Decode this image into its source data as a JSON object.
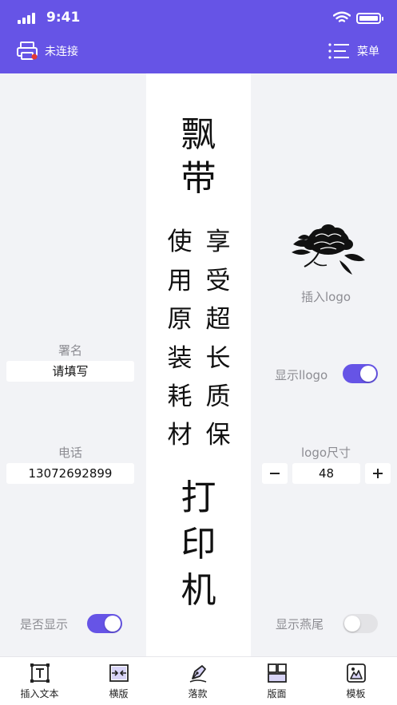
{
  "status_bar": {
    "time": "9:41"
  },
  "header": {
    "printer_label": "未连接",
    "menu_label": "菜单"
  },
  "canvas": {
    "top_line": [
      "飘",
      "带"
    ],
    "left_column": [
      "使",
      "用",
      "原",
      "装",
      "耗",
      "材"
    ],
    "right_column": [
      "享",
      "受",
      "超",
      "长",
      "质",
      "保"
    ],
    "bottom_line": [
      "打",
      "印",
      "机"
    ]
  },
  "left_panel": {
    "signature_label": "署名",
    "signature_placeholder": "请填写",
    "phone_label": "电话",
    "phone_value": "13072692899",
    "show_label": "是否显示",
    "show_on": true
  },
  "right_panel": {
    "insert_logo_label": "插入logo",
    "show_logo_label": "显示llogo",
    "show_logo_on": true,
    "logo_size_label": "logo尺寸",
    "logo_size_value": "48",
    "swallowtail_label": "显示燕尾",
    "swallowtail_on": false
  },
  "tabbar": {
    "tabs": [
      {
        "label": "插入文本",
        "icon": "insert-text-icon"
      },
      {
        "label": "横版",
        "icon": "horizontal-layout-icon"
      },
      {
        "label": "落款",
        "icon": "signature-pen-icon"
      },
      {
        "label": "版面",
        "icon": "layout-grid-icon"
      },
      {
        "label": "模板",
        "icon": "template-icon"
      }
    ]
  },
  "colors": {
    "accent": "#6654e6",
    "background": "#f2f3f6",
    "muted_text": "#8d8d93"
  }
}
